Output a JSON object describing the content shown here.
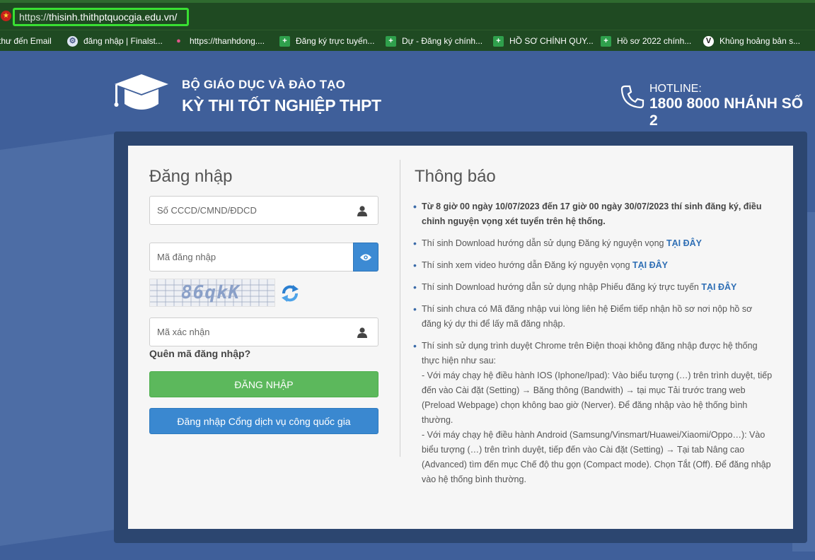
{
  "browser": {
    "url_scheme": "https://",
    "url_host": "thisinh.thithptquocgia.edu.vn/",
    "bookmarks": [
      {
        "label": "thư đến Email",
        "icon": "none"
      },
      {
        "label": "đăng nhập | Finalst...",
        "icon": "gear-icon"
      },
      {
        "label": "https://thanhdong....",
        "icon": "pink-icon"
      },
      {
        "label": "Đăng ký trực tuyến...",
        "icon": "green-icon"
      },
      {
        "label": "Dự - Đăng ký chính...",
        "icon": "green-icon"
      },
      {
        "label": "HỒ SƠ CHÍNH QUY...",
        "icon": "green-icon"
      },
      {
        "label": "Hồ sơ  2022 chính...",
        "icon": "green-icon"
      },
      {
        "label": "Khủng hoảng bản s...",
        "icon": "v-icon"
      }
    ]
  },
  "header": {
    "org": "BỘ GIÁO DỤC VÀ ĐÀO TẠO",
    "exam": "KỲ THI TỐT NGHIỆP THPT",
    "hotline_label": "HOTLINE:",
    "hotline_number": "1800 8000 NHÁNH SỐ 2"
  },
  "login": {
    "title": "Đăng nhập",
    "id_placeholder": "Số CCCD/CMND/ĐDCD",
    "code_placeholder": "Mã đăng nhập",
    "captcha_text": "86qkK",
    "verify_placeholder": "Mã xác nhận",
    "forgot": "Quên mã đăng nhập?",
    "login_button": "ĐĂNG NHẬP",
    "gov_button": "Đăng nhập Cổng dịch vụ công quốc gia"
  },
  "notices": {
    "title": "Thông báo",
    "items": [
      {
        "text": "Từ 8 giờ 00 ngày 10/07/2023 đến 17 giờ 00 ngày 30/07/2023 thí sinh đăng ký, điều chỉnh nguyện vọng xét tuyển trên hệ thống."
      },
      {
        "text": "Thí sinh Download hướng dẫn sử dụng Đăng ký nguyện vọng ",
        "link": "TẠI ĐÂY"
      },
      {
        "text": "Thí sinh xem video hướng dẫn Đăng ký nguyện vọng ",
        "link": "TẠI ĐÂY"
      },
      {
        "text": "Thí sinh Download hướng dẫn sử dụng nhập Phiếu đăng ký trực tuyến ",
        "link": "TẠI ĐÂY"
      },
      {
        "text": "Thí sinh chưa có Mã đăng nhập vui lòng liên hệ Điểm tiếp nhận hồ sơ nơi nộp hồ sơ đăng ký dự thi để lấy mã đăng nhập."
      },
      {
        "text": "Thí sinh sử dụng trình duyệt Chrome trên Điện thoại không đăng nhập được hệ thống thực hiện như sau:",
        "sub1": " - Với máy chạy hệ điều hành IOS (Iphone/Ipad): Vào biểu tượng (…) trên trình duyệt, tiếp đến vào Cài đặt (Setting) → Băng thông (Bandwith) → tại mục Tải trước trang web (Preload Webpage) chọn không bao giờ (Nerver). Để đăng nhập vào hệ thống bình thường.",
        "sub2": " - Với máy chạy hệ điều hành Android (Samsung/Vinsmart/Huawei/Xiaomi/Oppo…): Vào biểu tượng (…) trên trình duyệt, tiếp đến vào Cài đặt (Setting) → Tại tab Nâng cao (Advanced) tìm đến mục Chế độ thu gọn (Compact mode). Chọn Tắt (Off). Để đăng nhập vào hệ thống bình thường."
      }
    ]
  },
  "colors": {
    "page_bg": "#3f5f9a",
    "chrome_bg": "#1f4a22",
    "url_highlight": "#39e032",
    "login_green": "#5cb85c",
    "gov_blue": "#3a88d0",
    "link_blue": "#2f6fb5"
  }
}
